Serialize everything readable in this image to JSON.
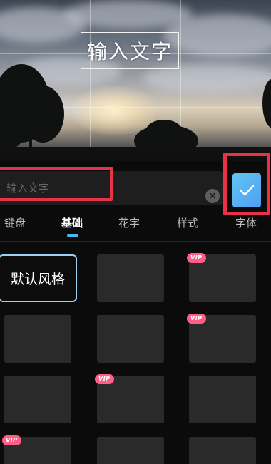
{
  "preview": {
    "overlay_text": "输入文字"
  },
  "input": {
    "placeholder": "输入文字",
    "value": "",
    "clear_icon": "close-icon"
  },
  "confirm": {
    "icon": "checkmark-icon",
    "accent_color": "#4f9ef2"
  },
  "tabs": [
    {
      "label": "键盘",
      "active": false
    },
    {
      "label": "基础",
      "active": true
    },
    {
      "label": "花字",
      "active": false
    },
    {
      "label": "样式",
      "active": false
    },
    {
      "label": "字体",
      "active": false
    }
  ],
  "styles": {
    "default_label": "默认风格",
    "vip_badge": "VIP",
    "highlight_color": "#e8324a"
  }
}
